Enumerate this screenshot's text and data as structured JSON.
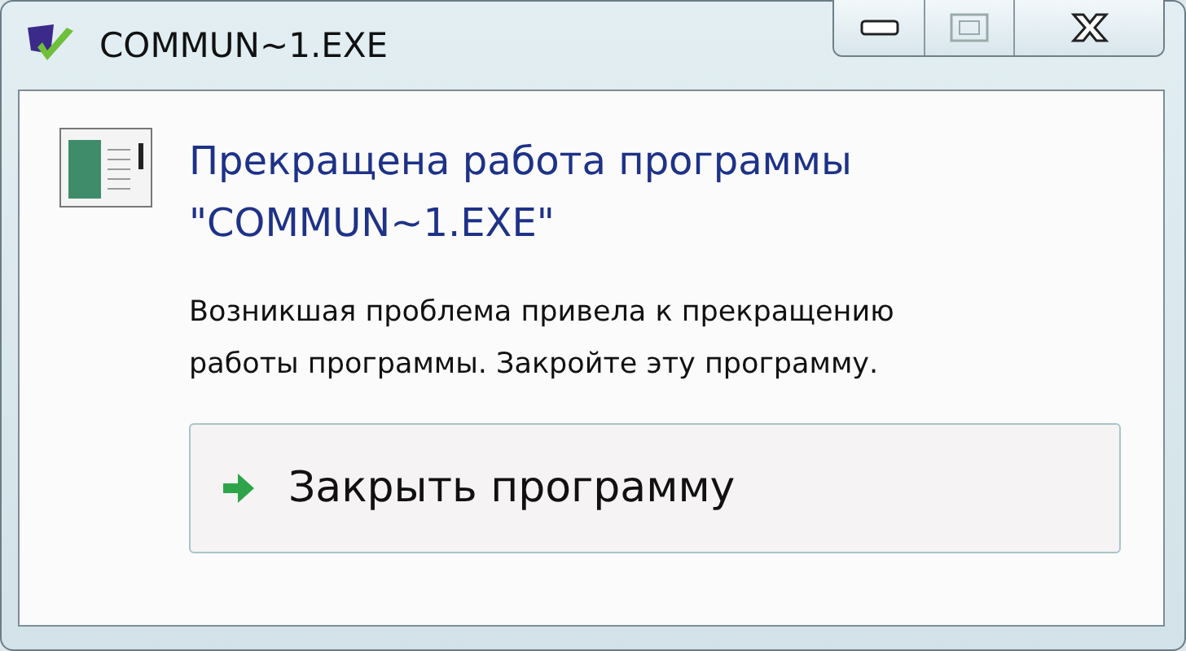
{
  "window": {
    "title": "COMMUN~1.EXE"
  },
  "dialog": {
    "heading": "Прекращена работа программы \"COMMUN~1.EXE\"",
    "message": "Возникшая проблема привела к прекращению работы программы. Закройте эту программу.",
    "commands": [
      {
        "label": "Закрыть программу"
      }
    ]
  }
}
